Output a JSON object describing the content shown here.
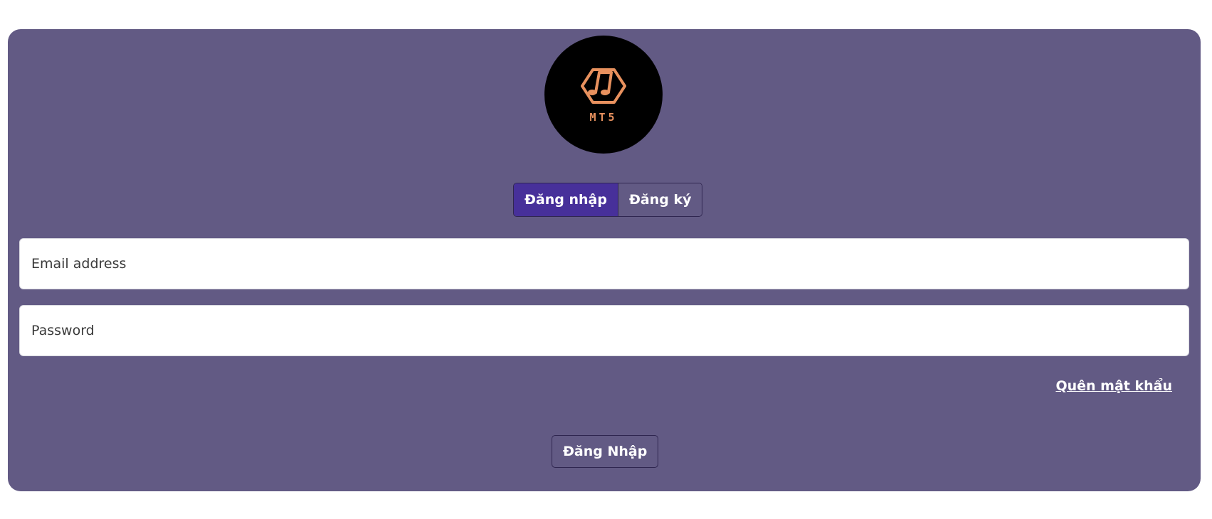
{
  "logo": {
    "text": "MT5",
    "icon": "music-note-hexagon-icon",
    "color": "#e8915e",
    "background": "#000000"
  },
  "tabs": [
    {
      "label": "Đăng nhập",
      "active": true
    },
    {
      "label": "Đăng ký",
      "active": false
    }
  ],
  "form": {
    "email_placeholder": "Email address",
    "email_value": "",
    "password_placeholder": "Password",
    "password_value": "",
    "forgot_label": "Quên mật khẩu",
    "submit_label": "Đăng Nhập"
  },
  "colors": {
    "card_background": "#625a84",
    "active_tab": "#47309a",
    "border": "#2f2650"
  }
}
